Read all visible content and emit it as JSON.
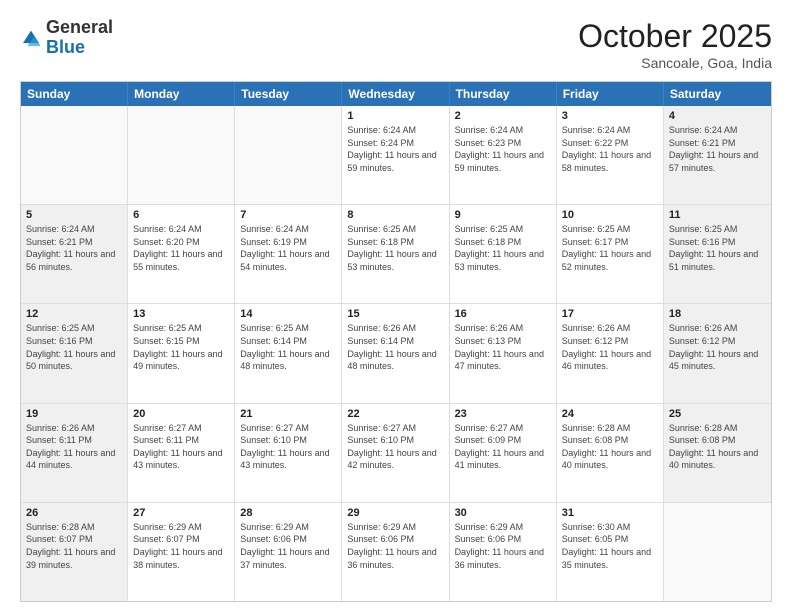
{
  "logo": {
    "general": "General",
    "blue": "Blue"
  },
  "header": {
    "month": "October 2025",
    "location": "Sancoale, Goa, India"
  },
  "weekdays": [
    "Sunday",
    "Monday",
    "Tuesday",
    "Wednesday",
    "Thursday",
    "Friday",
    "Saturday"
  ],
  "rows": [
    [
      {
        "day": "",
        "info": "",
        "empty": true
      },
      {
        "day": "",
        "info": "",
        "empty": true
      },
      {
        "day": "",
        "info": "",
        "empty": true
      },
      {
        "day": "1",
        "info": "Sunrise: 6:24 AM\nSunset: 6:24 PM\nDaylight: 11 hours and 59 minutes."
      },
      {
        "day": "2",
        "info": "Sunrise: 6:24 AM\nSunset: 6:23 PM\nDaylight: 11 hours and 59 minutes."
      },
      {
        "day": "3",
        "info": "Sunrise: 6:24 AM\nSunset: 6:22 PM\nDaylight: 11 hours and 58 minutes."
      },
      {
        "day": "4",
        "info": "Sunrise: 6:24 AM\nSunset: 6:21 PM\nDaylight: 11 hours and 57 minutes."
      }
    ],
    [
      {
        "day": "5",
        "info": "Sunrise: 6:24 AM\nSunset: 6:21 PM\nDaylight: 11 hours and 56 minutes."
      },
      {
        "day": "6",
        "info": "Sunrise: 6:24 AM\nSunset: 6:20 PM\nDaylight: 11 hours and 55 minutes."
      },
      {
        "day": "7",
        "info": "Sunrise: 6:24 AM\nSunset: 6:19 PM\nDaylight: 11 hours and 54 minutes."
      },
      {
        "day": "8",
        "info": "Sunrise: 6:25 AM\nSunset: 6:18 PM\nDaylight: 11 hours and 53 minutes."
      },
      {
        "day": "9",
        "info": "Sunrise: 6:25 AM\nSunset: 6:18 PM\nDaylight: 11 hours and 53 minutes."
      },
      {
        "day": "10",
        "info": "Sunrise: 6:25 AM\nSunset: 6:17 PM\nDaylight: 11 hours and 52 minutes."
      },
      {
        "day": "11",
        "info": "Sunrise: 6:25 AM\nSunset: 6:16 PM\nDaylight: 11 hours and 51 minutes."
      }
    ],
    [
      {
        "day": "12",
        "info": "Sunrise: 6:25 AM\nSunset: 6:16 PM\nDaylight: 11 hours and 50 minutes."
      },
      {
        "day": "13",
        "info": "Sunrise: 6:25 AM\nSunset: 6:15 PM\nDaylight: 11 hours and 49 minutes."
      },
      {
        "day": "14",
        "info": "Sunrise: 6:25 AM\nSunset: 6:14 PM\nDaylight: 11 hours and 48 minutes."
      },
      {
        "day": "15",
        "info": "Sunrise: 6:26 AM\nSunset: 6:14 PM\nDaylight: 11 hours and 48 minutes."
      },
      {
        "day": "16",
        "info": "Sunrise: 6:26 AM\nSunset: 6:13 PM\nDaylight: 11 hours and 47 minutes."
      },
      {
        "day": "17",
        "info": "Sunrise: 6:26 AM\nSunset: 6:12 PM\nDaylight: 11 hours and 46 minutes."
      },
      {
        "day": "18",
        "info": "Sunrise: 6:26 AM\nSunset: 6:12 PM\nDaylight: 11 hours and 45 minutes."
      }
    ],
    [
      {
        "day": "19",
        "info": "Sunrise: 6:26 AM\nSunset: 6:11 PM\nDaylight: 11 hours and 44 minutes."
      },
      {
        "day": "20",
        "info": "Sunrise: 6:27 AM\nSunset: 6:11 PM\nDaylight: 11 hours and 43 minutes."
      },
      {
        "day": "21",
        "info": "Sunrise: 6:27 AM\nSunset: 6:10 PM\nDaylight: 11 hours and 43 minutes."
      },
      {
        "day": "22",
        "info": "Sunrise: 6:27 AM\nSunset: 6:10 PM\nDaylight: 11 hours and 42 minutes."
      },
      {
        "day": "23",
        "info": "Sunrise: 6:27 AM\nSunset: 6:09 PM\nDaylight: 11 hours and 41 minutes."
      },
      {
        "day": "24",
        "info": "Sunrise: 6:28 AM\nSunset: 6:08 PM\nDaylight: 11 hours and 40 minutes."
      },
      {
        "day": "25",
        "info": "Sunrise: 6:28 AM\nSunset: 6:08 PM\nDaylight: 11 hours and 40 minutes."
      }
    ],
    [
      {
        "day": "26",
        "info": "Sunrise: 6:28 AM\nSunset: 6:07 PM\nDaylight: 11 hours and 39 minutes."
      },
      {
        "day": "27",
        "info": "Sunrise: 6:29 AM\nSunset: 6:07 PM\nDaylight: 11 hours and 38 minutes."
      },
      {
        "day": "28",
        "info": "Sunrise: 6:29 AM\nSunset: 6:06 PM\nDaylight: 11 hours and 37 minutes."
      },
      {
        "day": "29",
        "info": "Sunrise: 6:29 AM\nSunset: 6:06 PM\nDaylight: 11 hours and 36 minutes."
      },
      {
        "day": "30",
        "info": "Sunrise: 6:29 AM\nSunset: 6:06 PM\nDaylight: 11 hours and 36 minutes."
      },
      {
        "day": "31",
        "info": "Sunrise: 6:30 AM\nSunset: 6:05 PM\nDaylight: 11 hours and 35 minutes."
      },
      {
        "day": "",
        "info": "",
        "empty": true
      }
    ]
  ]
}
